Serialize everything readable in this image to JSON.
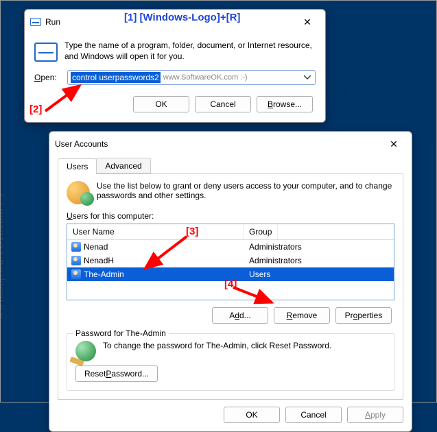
{
  "annotations": {
    "a1": "[1]  [Windows-Logo]+[R]",
    "a2": "[2]",
    "a3": "[3]",
    "a4": "[4]"
  },
  "run": {
    "title": "Run",
    "description": "Type the name of a program, folder, document, or Internet resource, and Windows will open it for you.",
    "open_label": "Open:",
    "input_value": "control userpasswords2",
    "input_hint": "www.SoftwareOK.com :-)",
    "ok": "OK",
    "cancel": "Cancel",
    "browse": "Browse..."
  },
  "ua": {
    "title": "User Accounts",
    "tabs": {
      "users": "Users",
      "advanced": "Advanced"
    },
    "info": "Use the list below to grant or deny users access to your computer, and to change passwords and other settings.",
    "list_label": "Users for this computer:",
    "col_user": "User Name",
    "col_group": "Group",
    "rows": [
      {
        "name": "Nenad",
        "group": "Administrators"
      },
      {
        "name": "NenadH",
        "group": "Administrators"
      },
      {
        "name": "The-Admin",
        "group": "Users"
      }
    ],
    "add": "Add...",
    "remove": "Remove",
    "properties": "Properties",
    "pw_legend": "Password for The-Admin",
    "pw_text": "To change the password for The-Admin, click Reset Password.",
    "reset": "Reset Password...",
    "ok": "OK",
    "cancel": "Cancel",
    "apply": "Apply"
  },
  "watermark": "www.SoftwareOK.com :-)"
}
